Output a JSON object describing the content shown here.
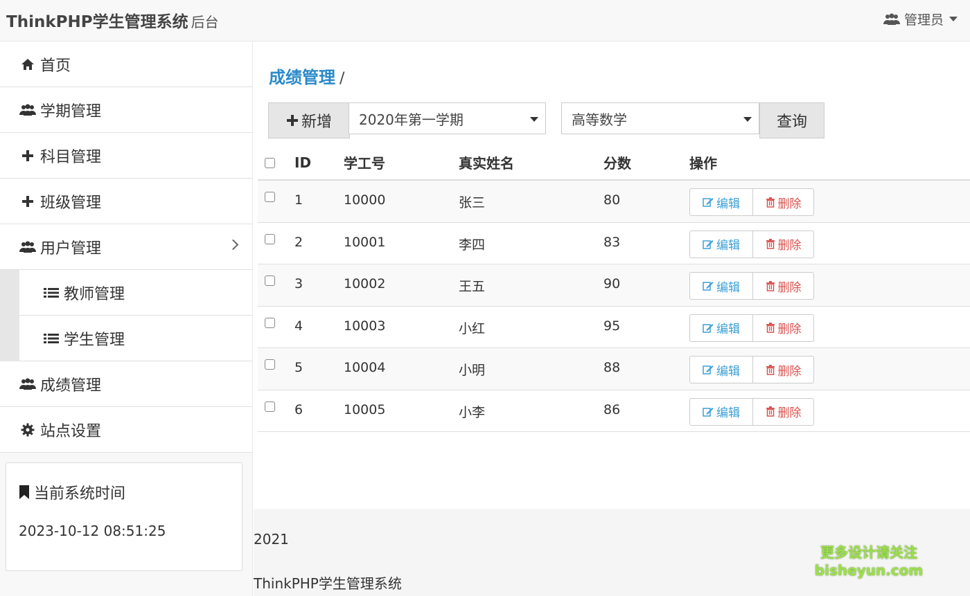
{
  "header": {
    "brand": "ThinkPHP学生管理系统",
    "brand_sub": "后台",
    "user": "管理员"
  },
  "sidebar": {
    "items": [
      {
        "label": "首页",
        "icon": "home-icon"
      },
      {
        "label": "学期管理",
        "icon": "users-icon"
      },
      {
        "label": "科目管理",
        "icon": "plus-icon"
      },
      {
        "label": "班级管理",
        "icon": "plus-icon"
      },
      {
        "label": "用户管理",
        "icon": "users-icon"
      },
      {
        "label": "教师管理",
        "icon": "list-icon"
      },
      {
        "label": "学生管理",
        "icon": "list-icon"
      },
      {
        "label": "成绩管理",
        "icon": "users-icon"
      },
      {
        "label": "站点设置",
        "icon": "gear-icon"
      }
    ],
    "time_panel": {
      "title": "当前系统时间",
      "value": "2023-10-12 08:51:25"
    }
  },
  "main": {
    "breadcrumb": "成绩管理",
    "breadcrumb_sep": "/",
    "toolbar": {
      "add_label": "新增",
      "term_value": "2020年第一学期",
      "subject_value": "高等数学",
      "query_label": "查询"
    },
    "table": {
      "headers": [
        "ID",
        "学工号",
        "真实姓名",
        "分数",
        "操作"
      ],
      "rows": [
        {
          "id": "1",
          "no": "10000",
          "name": "张三",
          "score": "80"
        },
        {
          "id": "2",
          "no": "10001",
          "name": "李四",
          "score": "83"
        },
        {
          "id": "3",
          "no": "10002",
          "name": "王五",
          "score": "90"
        },
        {
          "id": "4",
          "no": "10003",
          "name": "小红",
          "score": "95"
        },
        {
          "id": "5",
          "no": "10004",
          "name": "小明",
          "score": "88"
        },
        {
          "id": "6",
          "no": "10005",
          "name": "小李",
          "score": "86"
        }
      ],
      "edit_label": "编辑",
      "delete_label": "删除"
    }
  },
  "footer": {
    "year": "2021",
    "name": "ThinkPHP学生管理系统",
    "watermark_line1": "更多设计请关注",
    "watermark_line2": "bisheyun.com"
  },
  "colors": {
    "link": "#2a8ac9",
    "edit": "#3b9fd6",
    "delete": "#d9534f",
    "watermark": "#9be04a"
  }
}
